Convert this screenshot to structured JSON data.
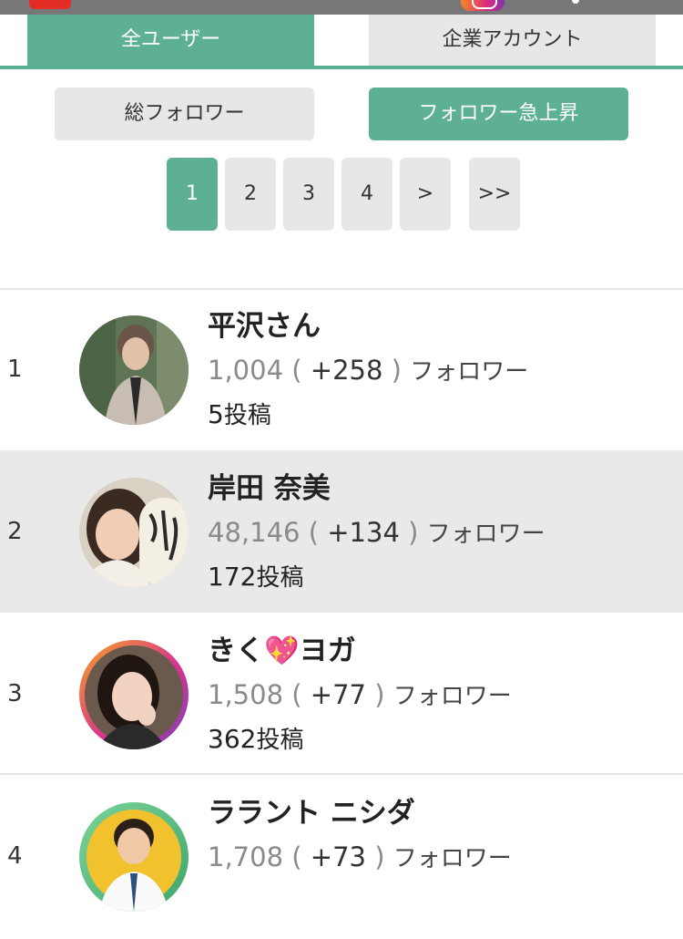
{
  "tabs": {
    "all_users": "全ユーザー",
    "company_accounts": "企業アカウント"
  },
  "sort": {
    "total_followers": "総フォロワー",
    "follower_surge": "フォロワー急上昇"
  },
  "pagination": {
    "pages": [
      "1",
      "2",
      "3",
      "4"
    ],
    "next": ">",
    "last": ">>",
    "current": "1"
  },
  "users": [
    {
      "rank": "1",
      "name": "平沢さん",
      "followers": "1,004",
      "gain": "+258",
      "followers_label": "フォロワー",
      "posts": "5",
      "posts_label": "投稿"
    },
    {
      "rank": "2",
      "name": "岸田 奈美",
      "followers": "48,146",
      "gain": "+134",
      "followers_label": "フォロワー",
      "posts": "172",
      "posts_label": "投稿"
    },
    {
      "rank": "3",
      "name": "きく💖ヨガ",
      "followers": "1,508",
      "gain": "+77",
      "followers_label": "フォロワー",
      "posts": "362",
      "posts_label": "投稿"
    },
    {
      "rank": "4",
      "name": "ララント ニシダ",
      "followers": "1,708",
      "gain": "+73",
      "followers_label": "フォロワー",
      "posts": "",
      "posts_label": ""
    }
  ],
  "colors": {
    "accent": "#5db192",
    "inactive": "#e7e7e9",
    "highlight_row": "#e9e9e9"
  },
  "icons": [
    "youtube-icon",
    "instagram-icon"
  ]
}
